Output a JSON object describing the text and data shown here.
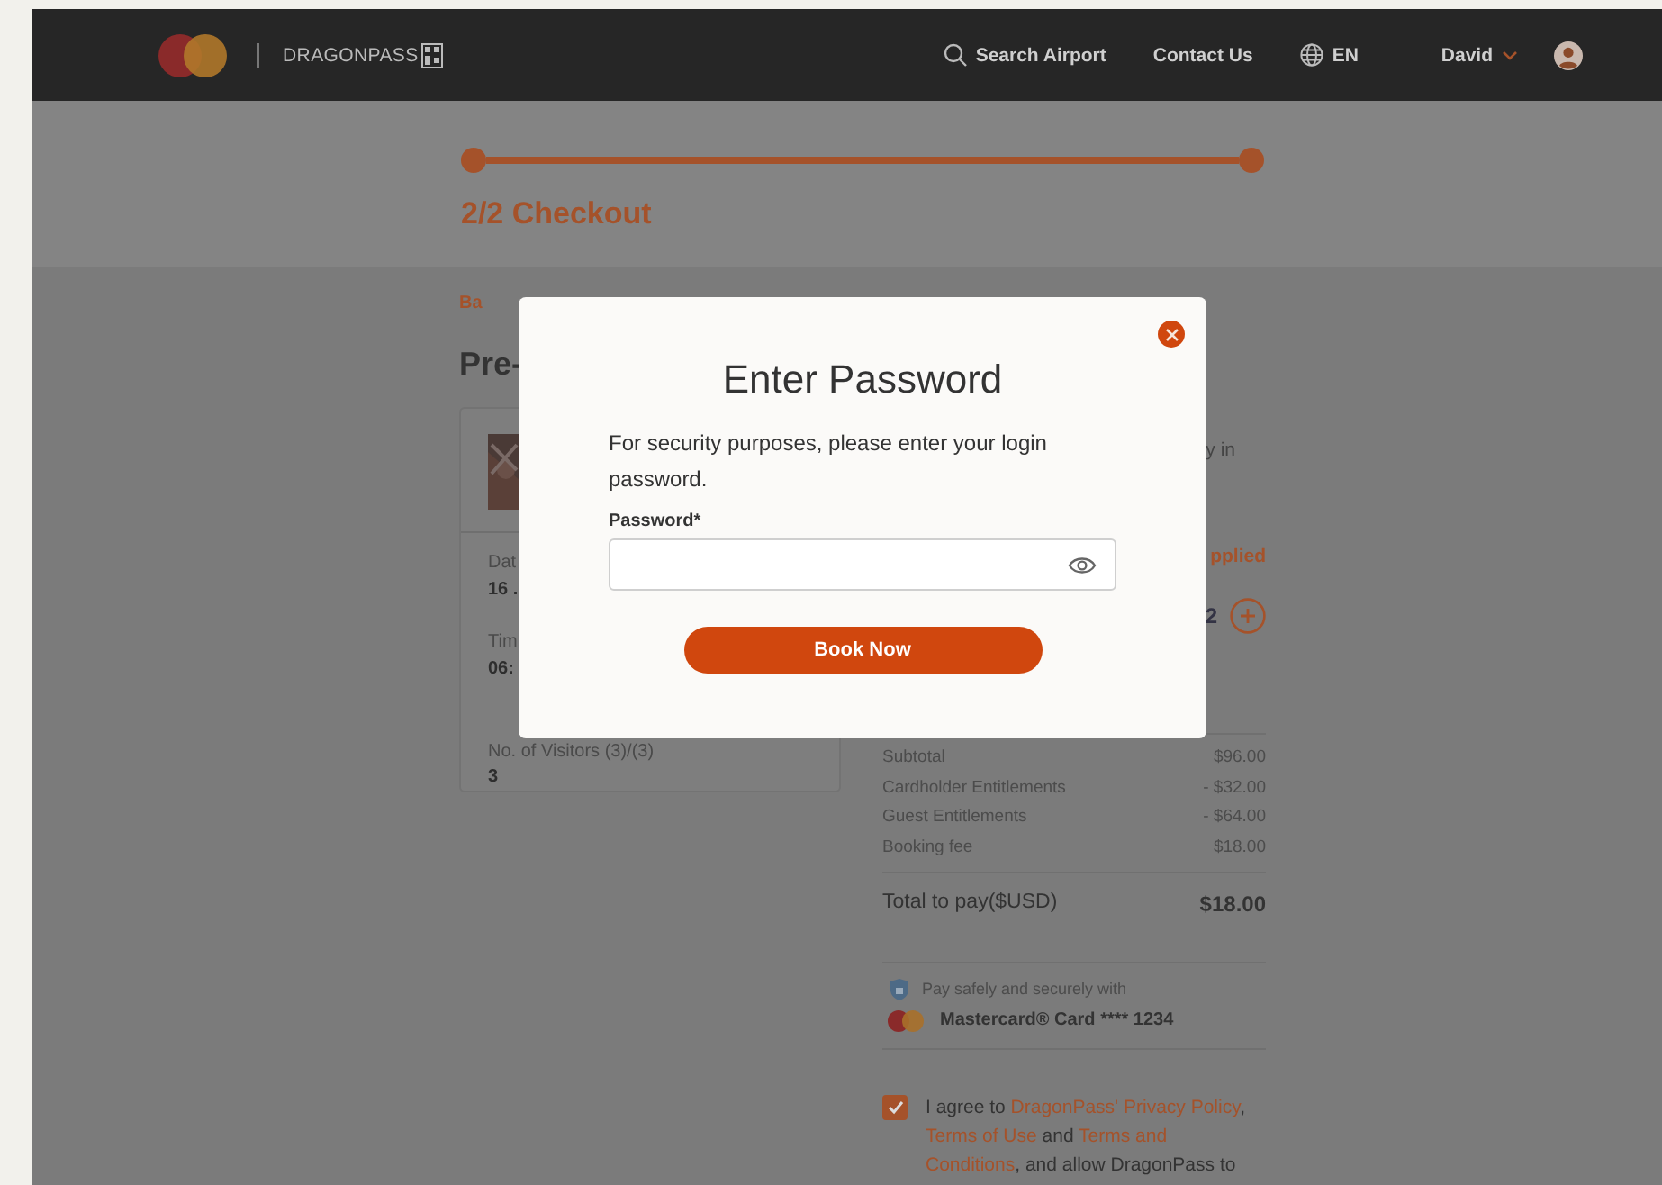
{
  "header": {
    "brand": "DRAGONPASS",
    "search": "Search Airport",
    "contact": "Contact Us",
    "language": "EN",
    "user": "David"
  },
  "checkout": {
    "progress": {
      "level": 1
    },
    "title": "2/2 Checkout"
  },
  "booking": {
    "back_link": "Ba",
    "page_title": "Pre-",
    "fields": [
      {
        "label": "Dat",
        "value": "16 ."
      },
      {
        "label": "Tim",
        "value": "06:"
      }
    ],
    "visitors_label": "No. of Visitors (3)/(3)",
    "visitors_value": "3"
  },
  "summary": {
    "note_fragment": "y in",
    "discount_fragment": "pplied",
    "count_fragment": "2",
    "rows": [
      {
        "label": "Subtotal",
        "value": "$96.00"
      },
      {
        "label": "Cardholder Entitlements",
        "value": "- $32.00"
      },
      {
        "label": "Guest Entitlements",
        "value": "- $64.00"
      },
      {
        "label": "Booking fee",
        "value": "$18.00"
      }
    ],
    "total_label": "Total to pay($USD)",
    "total_value": "$18.00",
    "secure_note": "Pay safely and securely with",
    "card": "Mastercard® Card **** 1234",
    "agreement": {
      "checked": true,
      "lines": [
        [
          {
            "kind": "text",
            "text": "I agree to "
          },
          {
            "kind": "link",
            "text": "DragonPass' Privacy Policy"
          },
          {
            "kind": "text",
            "text": ","
          }
        ],
        [
          {
            "kind": "link",
            "text": "Terms of Use"
          },
          {
            "kind": "text",
            "text": " and "
          },
          {
            "kind": "link",
            "text": "Terms and"
          }
        ],
        [
          {
            "kind": "link",
            "text": "Conditions"
          },
          {
            "kind": "text",
            "text": ", and allow DragonPass to"
          }
        ]
      ]
    }
  },
  "modal": {
    "title": "Enter Password",
    "message": "For security purposes, please enter your login password.",
    "field_label": "Password*",
    "button": "Book Now"
  }
}
